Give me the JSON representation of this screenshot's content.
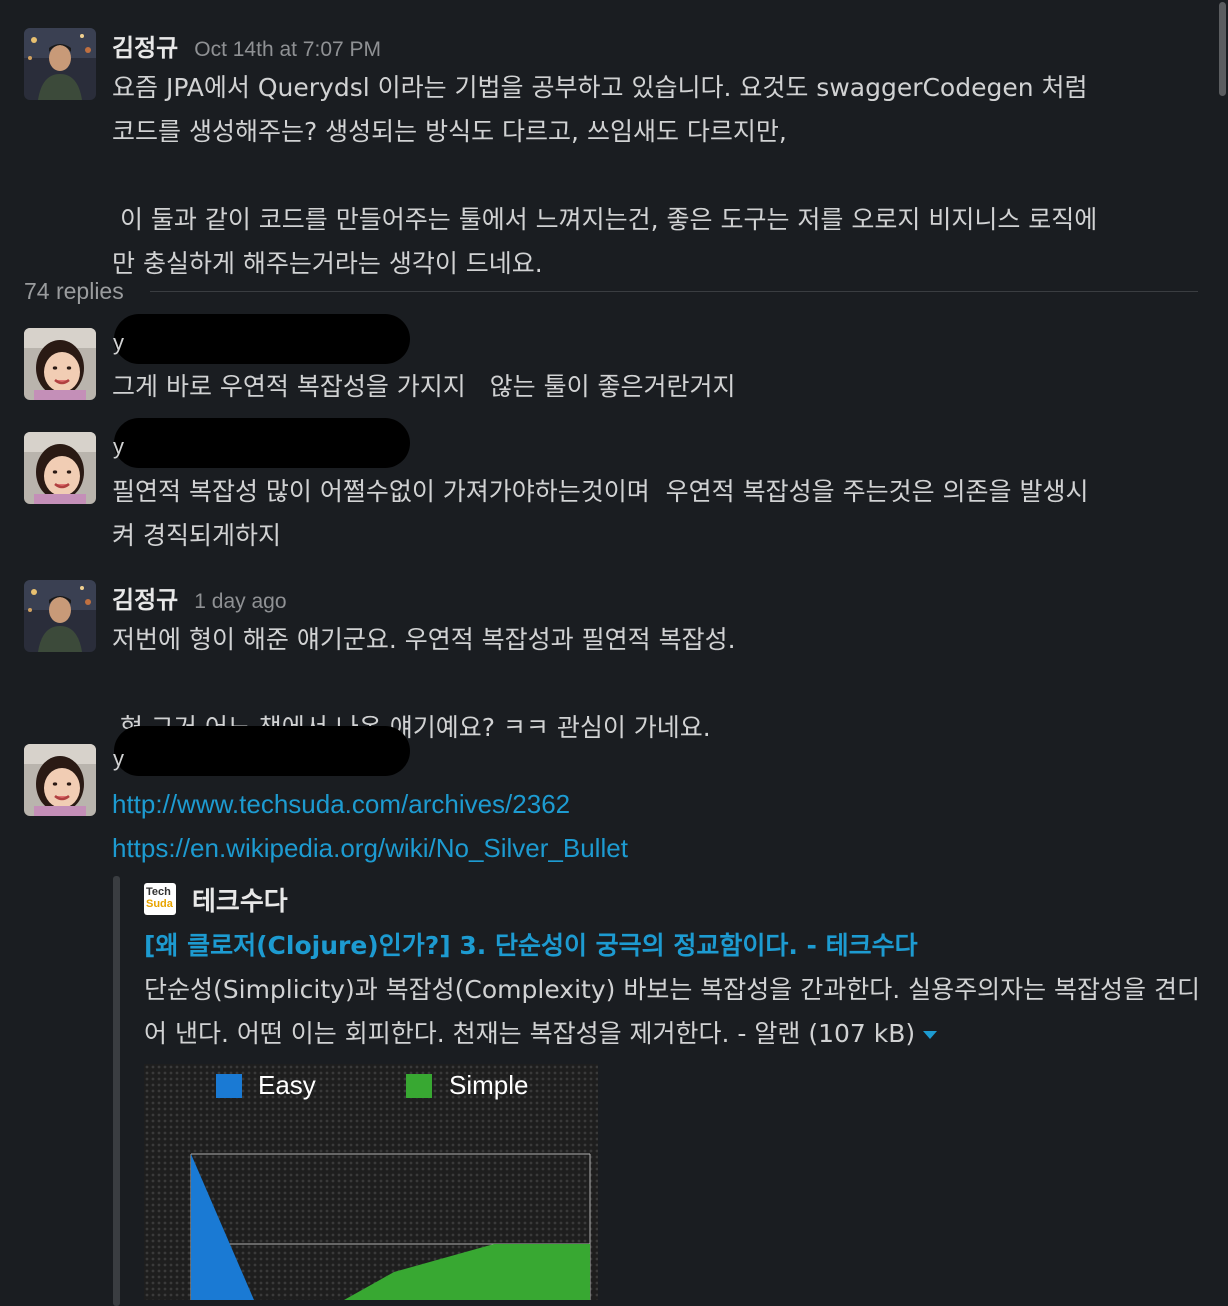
{
  "thread": {
    "replies_label": "74 replies"
  },
  "messages": [
    {
      "author": "김정규",
      "time": "Oct 14th at 7:07 PM",
      "text": "요즘 JPA에서 Querydsl 이라는 기법을 공부하고 있습니다. 요것도 swaggerCodegen 처럼\n코드를 생성해주는? 생성되는 방식도 다르고, 쓰임새도 다르지만,\n\n 이 둘과 같이 코드를 만들어주는 툴에서 느껴지는건, 좋은 도구는 저를 오로지 비지니스 로직에\n만 충실하게 해주는거라는 생각이 드네요."
    },
    {
      "author_hint": "y",
      "text": "그게 바로 우연적 복잡성을 가지지   않는 툴이 좋은거란거지"
    },
    {
      "author_hint": "y",
      "text": "필연적 복잡성 많이 어쩔수없이 가져가야하는것이며  우연적 복잡성을 주는것은 의존을 발생시\n켜 경직되게하지"
    },
    {
      "author": "김정규",
      "time": "1 day ago",
      "text": "저번에 형이 해준 얘기군요. 우연적 복잡성과 필연적 복잡성.\n\n 형 그거 어느 책에서 나온 얘기예요? ㅋㅋ 관심이 가네요."
    },
    {
      "author_hint": "y",
      "links": [
        "http://www.techsuda.com/archives/2362",
        "https://en.wikipedia.org/wiki/No_Silver_Bullet"
      ]
    }
  ],
  "attachment": {
    "icon_line1": "Tech",
    "icon_line2": "Suda",
    "site_name": "테크수다",
    "title": "[왜 클로저(Clojure)인가?] 3. 단순성이 궁극의 정교함이다. - 테크수다",
    "description": "단순성(Simplicity)과 복잡성(Complexity) 바보는 복잡성을 간과한다. 실용주의자는 복잡성을 견디어 낸다. 어떤 이는 회피한다. 천재는 복잡성을 제거한다. - 알랜 (107 kB)",
    "legend": [
      "Easy",
      "Simple"
    ],
    "colors": {
      "easy": "#1a7ad4",
      "simple": "#38a832"
    }
  }
}
